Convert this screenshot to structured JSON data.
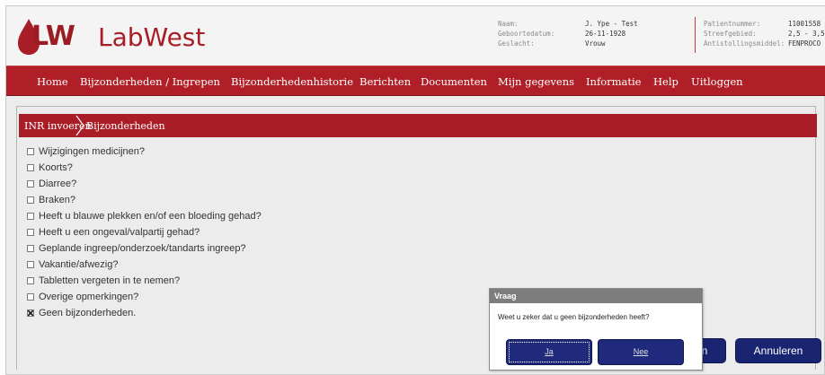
{
  "brand": {
    "logo_text": "LW",
    "name": "LabWest"
  },
  "patient": {
    "naam_label": "Naam:",
    "naam": "J. Ype - Test",
    "geboortedatum_label": "Geboortedatum:",
    "geboortedatum": "26-11-1928",
    "geslacht_label": "Geslacht:",
    "geslacht": "Vrouw",
    "patientnummer_label": "Patientnummer:",
    "patientnummer": "11001558",
    "streefgebied_label": "Streefgebied:",
    "streefgebied": "2,5 - 3,5",
    "antistollingsmiddel_label": "Antistollingsmiddel:",
    "antistollingsmiddel": "FENPROCO"
  },
  "nav": {
    "items": [
      {
        "label": "Home"
      },
      {
        "label": "Bijzonderheden / Ingrepen"
      },
      {
        "label": "Bijzonderhedenhistorie"
      },
      {
        "label": "Berichten"
      },
      {
        "label": "Documenten"
      },
      {
        "label": "Mijn gegevens"
      },
      {
        "label": "Informatie"
      },
      {
        "label": "Help"
      },
      {
        "label": "Uitloggen"
      }
    ]
  },
  "breadcrumb": {
    "step1": "INR invoeren",
    "step2": "Bijzonderheden"
  },
  "questions": [
    {
      "label": "Wijzigingen medicijnen?",
      "checked": false
    },
    {
      "label": "Koorts?",
      "checked": false
    },
    {
      "label": "Diarree?",
      "checked": false
    },
    {
      "label": "Braken?",
      "checked": false
    },
    {
      "label": "Heeft u blauwe plekken en/of een bloeding gehad?",
      "checked": false
    },
    {
      "label": "Heeft u een ongeval/valpartij gehad?",
      "checked": false
    },
    {
      "label": "Geplande ingreep/onderzoek/tandarts ingreep?",
      "checked": false
    },
    {
      "label": "Vakantie/afwezig?",
      "checked": false
    },
    {
      "label": "Tabletten vergeten in te nemen?",
      "checked": false
    },
    {
      "label": "Overige opmerkingen?",
      "checked": false
    },
    {
      "label": "Geen bijzonderheden.",
      "checked": true
    }
  ],
  "buttons": {
    "next_partial": "n",
    "annuleren": "Annuleren"
  },
  "dialog": {
    "title": "Vraag",
    "message": "Weet u zeker dat u geen bijzonderheden heeft?",
    "ja": "Ja",
    "nee": "Nee"
  },
  "colors": {
    "brand_red": "#b01f28",
    "button_navy": "#1a2572",
    "dialog_title": "#7d7d7d"
  }
}
